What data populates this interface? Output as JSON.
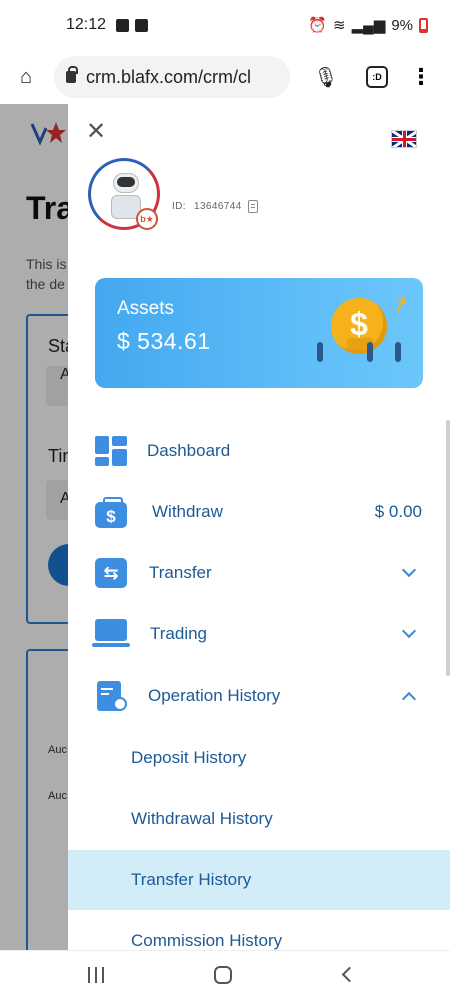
{
  "status_bar": {
    "time": "12:12",
    "battery": "9%"
  },
  "browser": {
    "url": "crm.blafx.com/crm/cl",
    "tabs_label": ":D"
  },
  "background_page": {
    "title": "Tra",
    "desc_line1": "This is",
    "desc_line2": "the de",
    "label_1": "Sta",
    "field_1": "A",
    "label_2": "Tin",
    "field_2": "A",
    "row_1": "Auc",
    "row_2": "Auc"
  },
  "drawer": {
    "user": {
      "id_label": "ID:",
      "id_value": "13646744"
    },
    "assets": {
      "label": "Assets",
      "value": "$ 534.61"
    },
    "menu": [
      {
        "label": "Dashboard"
      },
      {
        "label": "Withdraw",
        "value": "$ 0.00"
      },
      {
        "label": "Transfer"
      },
      {
        "label": "Trading"
      },
      {
        "label": "Operation History"
      }
    ],
    "submenu": [
      {
        "label": "Deposit History"
      },
      {
        "label": "Withdrawal History"
      },
      {
        "label": "Transfer History",
        "active": true
      },
      {
        "label": "Commission History"
      }
    ]
  },
  "colors": {
    "accent": "#3d8ee0",
    "menu_text": "#1d5a96",
    "active_bg": "#d2ecf8"
  }
}
